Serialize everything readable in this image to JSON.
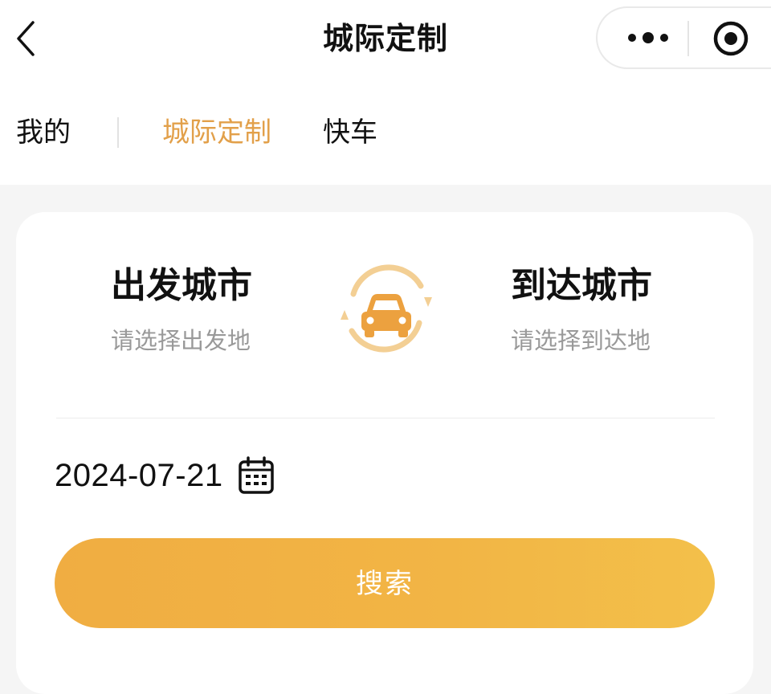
{
  "header": {
    "title": "城际定制",
    "back_icon": "chevron-left-icon",
    "more_icon": "more-dots-icon",
    "close_icon": "target-close-icon"
  },
  "tabs": [
    {
      "label": "我的",
      "active": false
    },
    {
      "label": "城际定制",
      "active": true
    },
    {
      "label": "快车",
      "active": false
    }
  ],
  "route": {
    "from": {
      "label": "出发城市",
      "hint": "请选择出发地"
    },
    "to": {
      "label": "到达城市",
      "hint": "请选择到达地"
    },
    "swap_icon": "car-swap-icon"
  },
  "date": {
    "value": "2024-07-21",
    "icon": "calendar-icon"
  },
  "search": {
    "label": "搜索"
  },
  "colors": {
    "accent": "#e2a04a",
    "button_start": "#f0ad42",
    "button_end": "#f3c04a",
    "hint": "#999999",
    "background": "#f5f5f5"
  }
}
